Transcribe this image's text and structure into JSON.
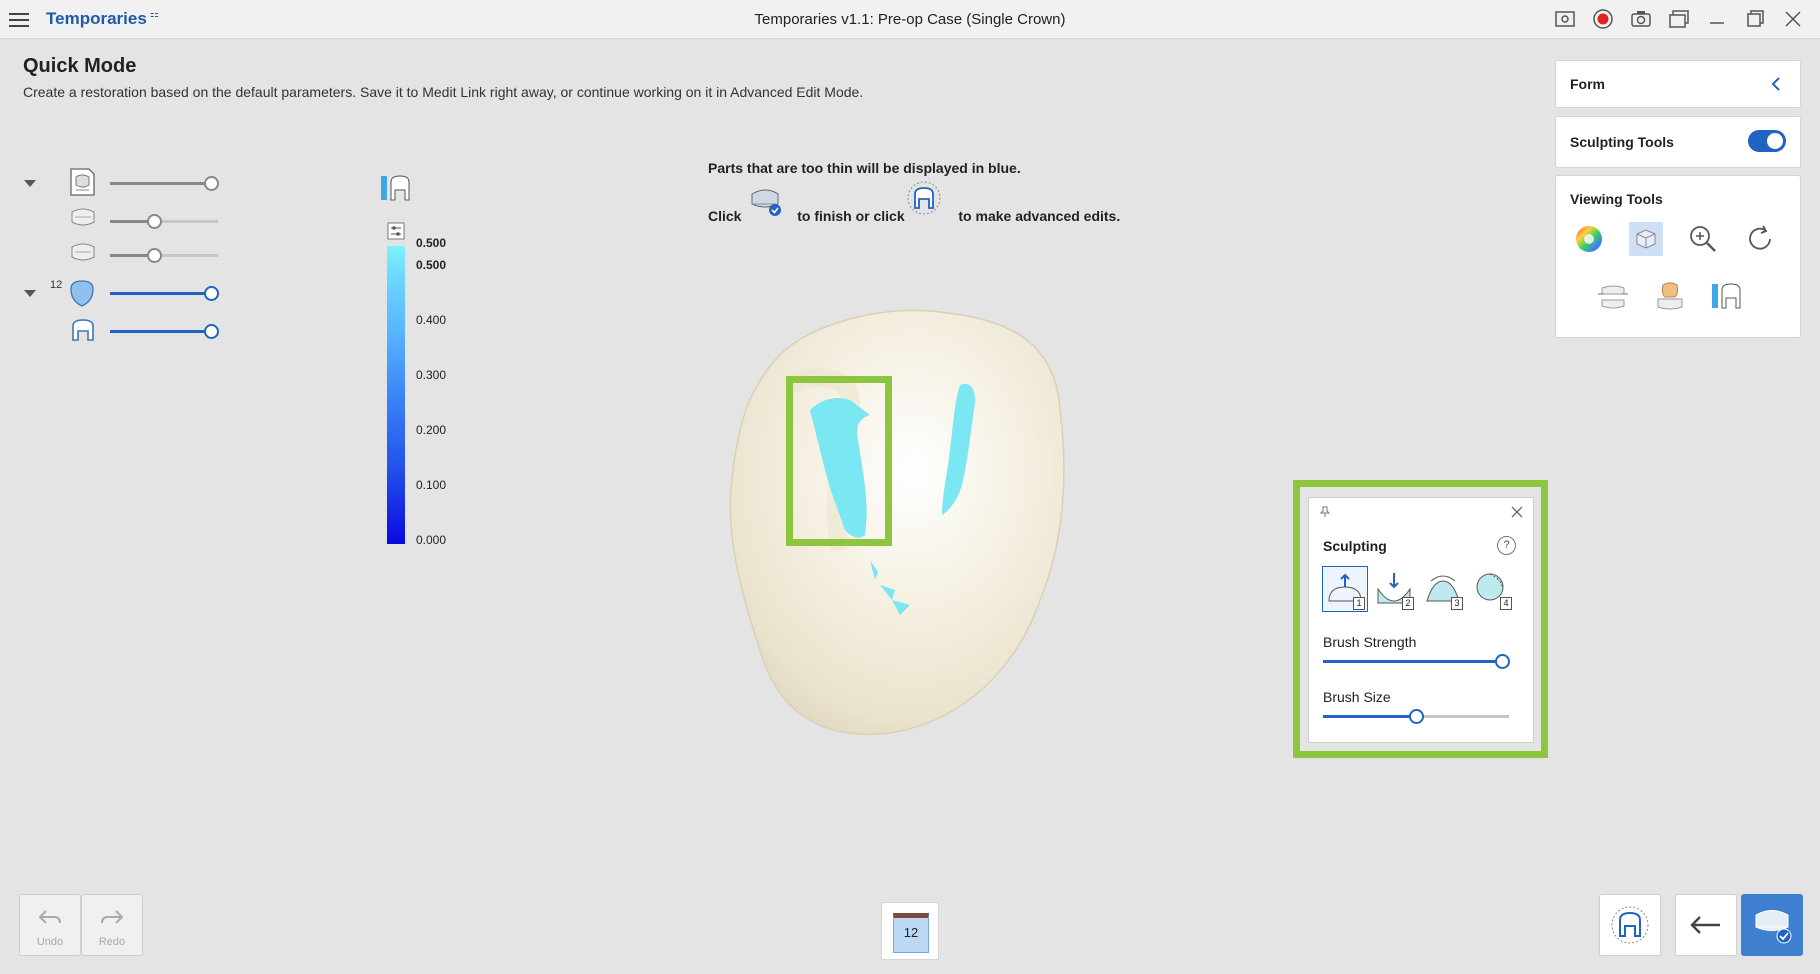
{
  "titlebar": {
    "app_name": "Temporaries",
    "app_badge": "⁲",
    "window_title": "Temporaries v1.1: Pre-op Case (Single Crown)",
    "icons": [
      "screenshot-gallery-icon",
      "record-icon",
      "camera-icon",
      "window-layout-icon",
      "minimize-icon",
      "maximize-icon",
      "close-icon"
    ]
  },
  "header": {
    "title": "Quick Mode",
    "description": "Create a restoration based on the default parameters. Save it to Medit Link right away, or continue working on it in Advanced Edit Mode."
  },
  "tree": {
    "tooth_number": "12",
    "rows": [
      {
        "icon": "scan-data-icon",
        "level": 1.0,
        "style": "gray"
      },
      {
        "icon": "upper-jaw-icon",
        "level": 0.4,
        "style": "gray"
      },
      {
        "icon": "lower-jaw-icon",
        "level": 0.4,
        "style": "gray"
      },
      {
        "icon": "crown-icon",
        "level": 1.0,
        "style": "blue"
      },
      {
        "icon": "tooth-outline-icon",
        "level": 1.0,
        "style": "blue"
      }
    ]
  },
  "thickness_scale": {
    "labels": [
      "0.500",
      "0.500",
      "0.400",
      "0.300",
      "0.200",
      "0.100",
      "0.000"
    ]
  },
  "messages": {
    "line1": "Parts that are too thin will be displayed in blue.",
    "click": "Click",
    "finish": "to finish or click",
    "advanced": "to make advanced edits."
  },
  "right_panel": {
    "form_label": "Form",
    "sculpting_tools_label": "Sculpting Tools",
    "sculpting_tools_on": true,
    "viewing_tools_label": "Viewing Tools"
  },
  "sculpting": {
    "title": "Sculpting",
    "help": "?",
    "modes": [
      "1",
      "2",
      "3",
      "4"
    ],
    "brush_strength_label": "Brush Strength",
    "brush_strength": 1.0,
    "brush_size_label": "Brush Size",
    "brush_size": 0.5
  },
  "bottom": {
    "undo": "Undo",
    "redo": "Redo",
    "tooth_tab": "12"
  },
  "colors": {
    "accent": "#1f64c0",
    "highlight": "#8cc63f",
    "thin_area": "#7ae7f2",
    "model": "#f3eee0"
  }
}
